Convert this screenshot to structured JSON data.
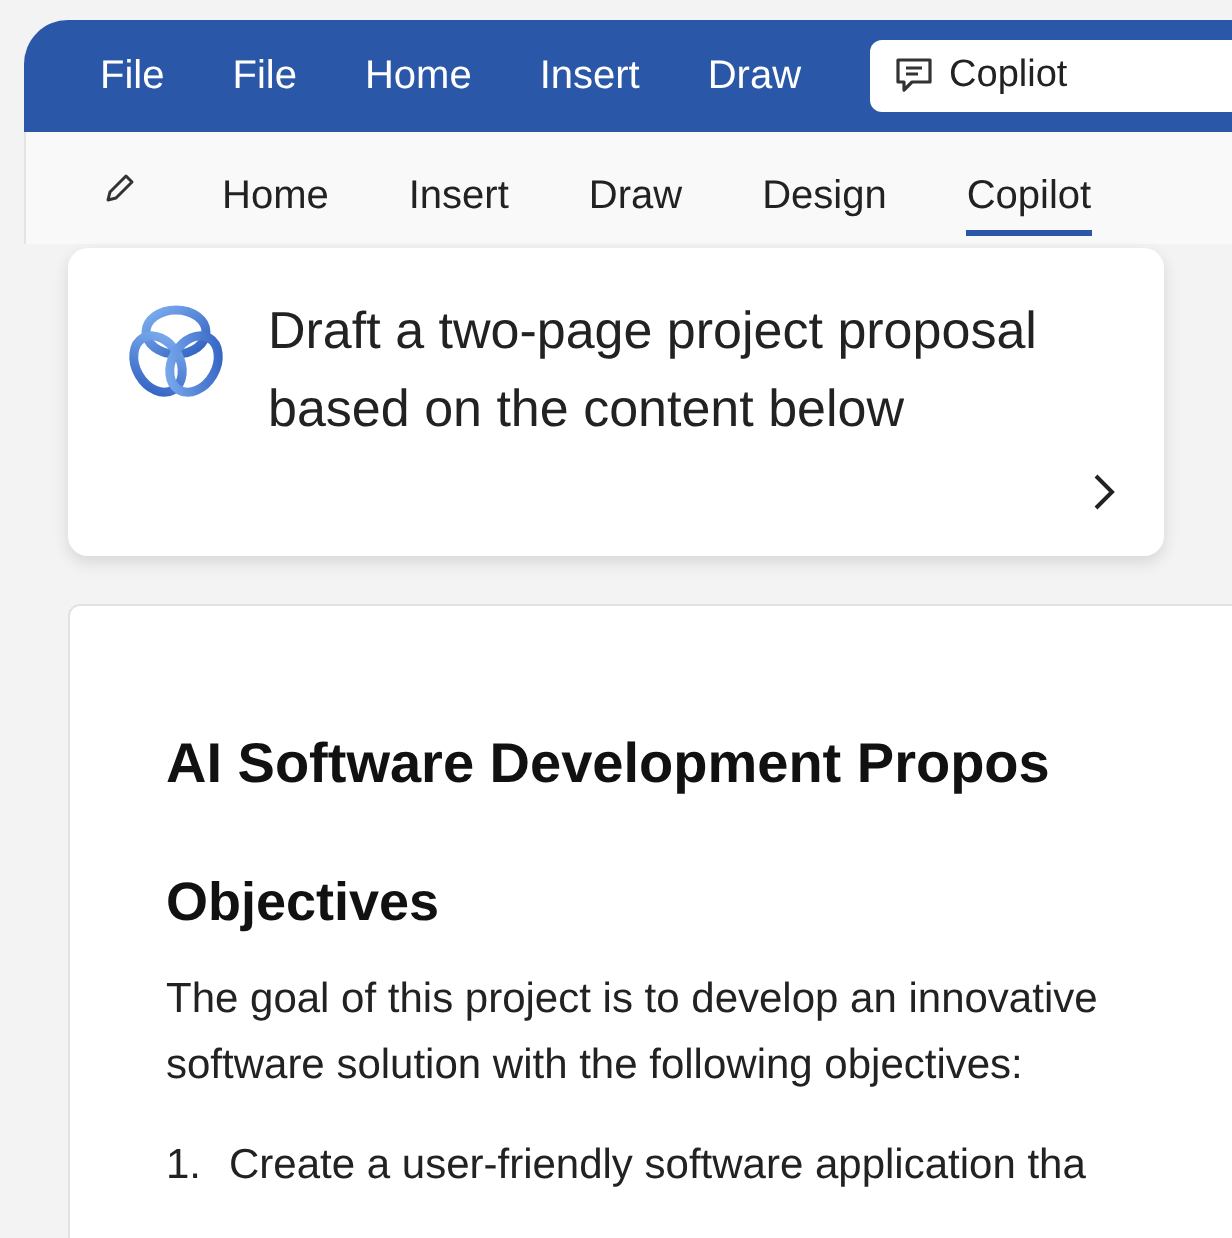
{
  "menu_bar": {
    "items": [
      "File",
      "File",
      "Home",
      "Insert",
      "Draw"
    ],
    "copilot_box": {
      "label": "Copliot"
    }
  },
  "ribbon_tabs": [
    {
      "label": "Home",
      "selected": false
    },
    {
      "label": "Insert",
      "selected": false
    },
    {
      "label": "Draw",
      "selected": false
    },
    {
      "label": "Design",
      "selected": false
    },
    {
      "label": "Copilot",
      "selected": true
    }
  ],
  "prompt_card": {
    "text": "Draft a two-page project proposal based on the content below"
  },
  "document": {
    "title": "AI Software Development Propos",
    "heading": "Objectives",
    "paragraph_lines": [
      "The goal of this project is to develop an innovative",
      "software solution with the following objectives:"
    ],
    "list_items": [
      {
        "number": "1.",
        "text": "Create a user-friendly software application tha"
      }
    ]
  }
}
